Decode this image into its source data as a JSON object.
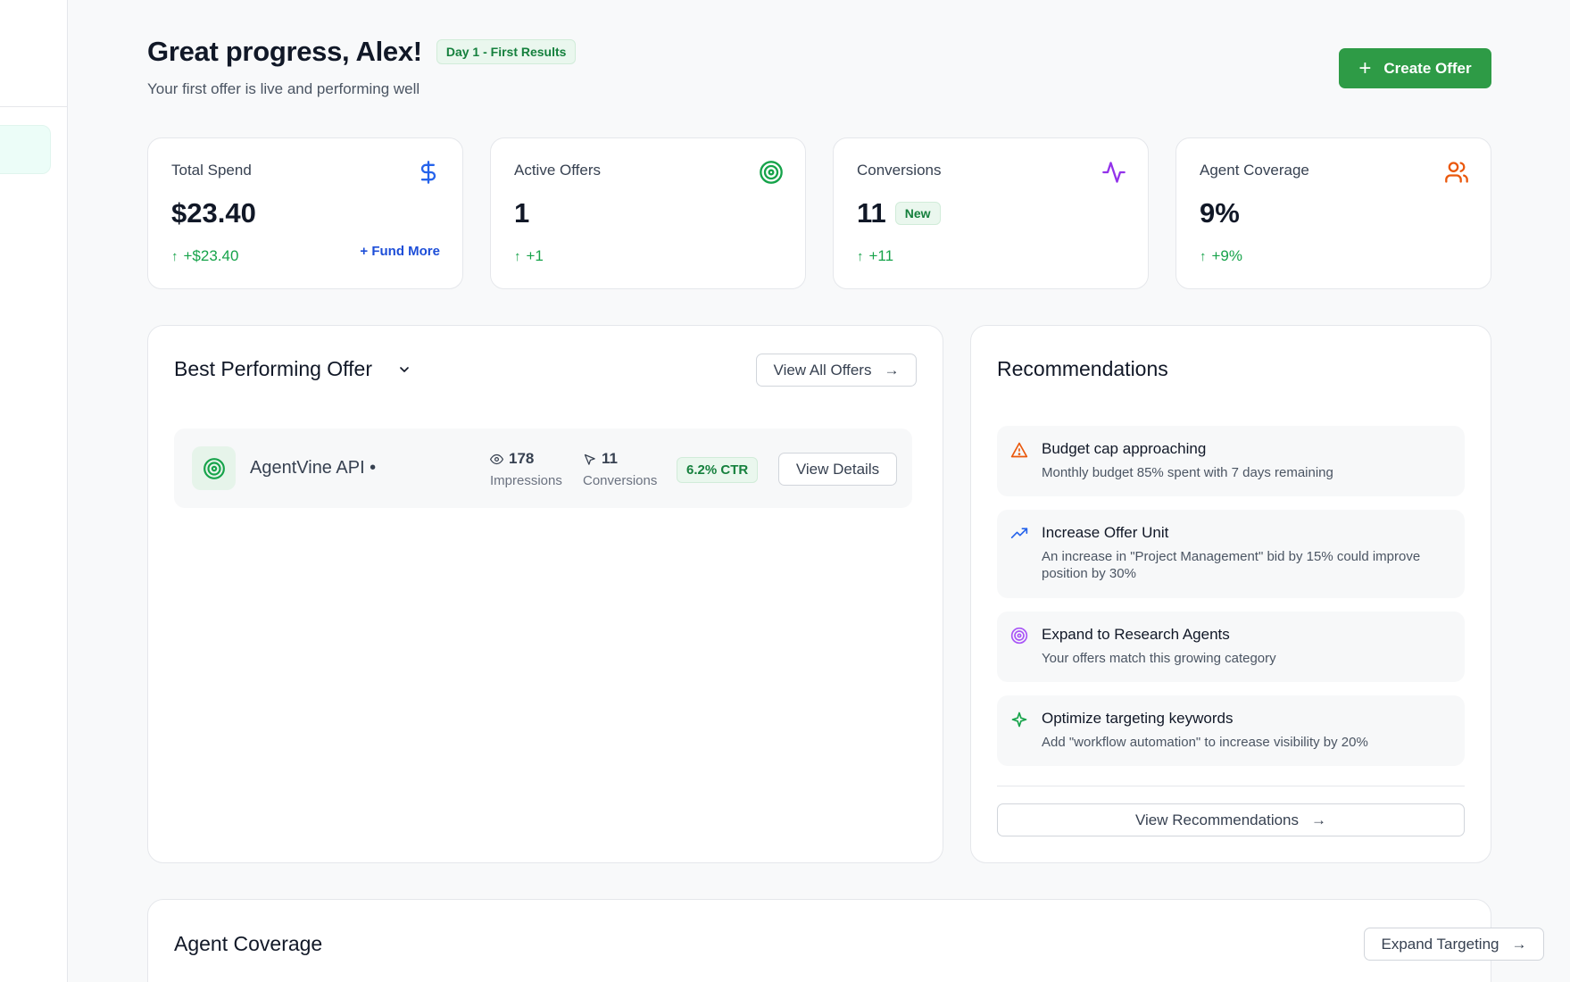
{
  "header": {
    "title": "Great progress, Alex!",
    "badge": "Day 1 - First Results",
    "subtitle": "Your first offer is live and performing well",
    "create_button": "Create Offer"
  },
  "stats": [
    {
      "label": "Total Spend",
      "value": "$23.40",
      "delta": "+$23.40",
      "action": "+ Fund More",
      "icon": "dollar-icon",
      "icon_color": "#2563eb"
    },
    {
      "label": "Active Offers",
      "value": "1",
      "delta": "+1",
      "icon": "target-icon",
      "icon_color": "#16a34a"
    },
    {
      "label": "Conversions",
      "value": "11",
      "badge": "New",
      "delta": "+11",
      "icon": "activity-icon",
      "icon_color": "#9333ea"
    },
    {
      "label": "Agent Coverage",
      "value": "9%",
      "delta": "+9%",
      "icon": "users-icon",
      "icon_color": "#ea580c"
    }
  ],
  "best_offer": {
    "title": "Best Performing Offer",
    "view_all": "View All Offers",
    "offer": {
      "name": "AgentVine API •",
      "impressions": "178",
      "impressions_label": "Impressions",
      "conversions": "11",
      "conversions_label": "Conversions",
      "ctr": "6.2% CTR",
      "details_button": "View Details"
    }
  },
  "recommendations": {
    "title": "Recommendations",
    "items": [
      {
        "title": "Budget cap approaching",
        "desc": "Monthly budget 85% spent with 7 days remaining",
        "icon": "warning-icon",
        "color": "#ea580c"
      },
      {
        "title": "Increase Offer Unit",
        "desc": "An increase in \"Project Management\" bid by 15% could improve position by 30%",
        "icon": "trending-up-icon",
        "color": "#2563eb"
      },
      {
        "title": "Expand to Research Agents",
        "desc": "Your offers match this growing category",
        "icon": "target-icon",
        "color": "#a855f7"
      },
      {
        "title": "Optimize targeting keywords",
        "desc": "Add \"workflow automation\" to increase visibility by 20%",
        "icon": "sparkle-icon",
        "color": "#16a34a"
      }
    ],
    "view_button": "View Recommendations"
  },
  "coverage": {
    "title": "Agent Coverage",
    "expand_button": "Expand Targeting"
  }
}
